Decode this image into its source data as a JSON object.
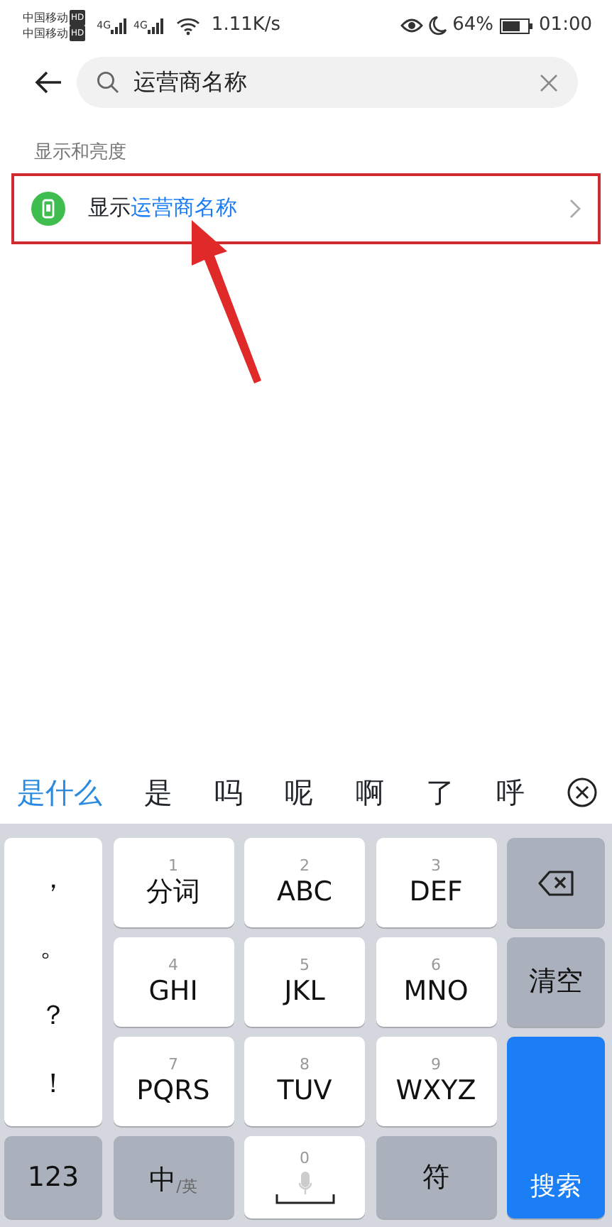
{
  "status_bar": {
    "carriers": [
      {
        "name": "中国移动",
        "badge": "HD"
      },
      {
        "name": "中国移动",
        "badge": "HD"
      }
    ],
    "networks": [
      "4G",
      "4G"
    ],
    "speed": "1.11K/s",
    "battery": "64%",
    "time": "01:00"
  },
  "search": {
    "value": "运营商名称"
  },
  "section": {
    "title": "显示和亮度"
  },
  "result": {
    "prefix": "显示",
    "highlight": "运营商名称",
    "annotated": true
  },
  "candidates": [
    {
      "text": "是什么",
      "selected": true
    },
    {
      "text": "是",
      "selected": false
    },
    {
      "text": "吗",
      "selected": false
    },
    {
      "text": "呢",
      "selected": false
    },
    {
      "text": "啊",
      "selected": false
    },
    {
      "text": "了",
      "selected": false
    },
    {
      "text": "呼",
      "selected": false
    }
  ],
  "keys": [
    {
      "kind": "punct",
      "chars": [
        "，",
        "。",
        "？",
        "！"
      ]
    },
    {
      "kind": "letter",
      "digit": "1",
      "label": "分词"
    },
    {
      "kind": "letter",
      "digit": "2",
      "label": "ABC"
    },
    {
      "kind": "letter",
      "digit": "3",
      "label": "DEF"
    },
    {
      "kind": "delete"
    },
    {
      "kind": "letter",
      "digit": "4",
      "label": "GHI"
    },
    {
      "kind": "letter",
      "digit": "5",
      "label": "JKL"
    },
    {
      "kind": "letter",
      "digit": "6",
      "label": "MNO"
    },
    {
      "kind": "function",
      "label": "清空"
    },
    {
      "kind": "letter",
      "digit": "7",
      "label": "PQRS"
    },
    {
      "kind": "letter",
      "digit": "8",
      "label": "TUV"
    },
    {
      "kind": "letter",
      "digit": "9",
      "label": "WXYZ"
    },
    {
      "kind": "function",
      "label": "123"
    },
    {
      "kind": "lang",
      "label": "中",
      "sublabel": "/英"
    },
    {
      "kind": "space",
      "digit": "0"
    },
    {
      "kind": "function",
      "label": "符"
    },
    {
      "kind": "primary",
      "label": "搜索"
    }
  ]
}
